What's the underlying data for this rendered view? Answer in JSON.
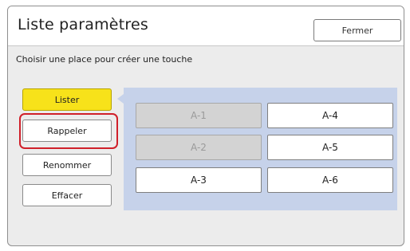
{
  "dialog": {
    "title": "Liste paramètres",
    "close_label": "Fermer",
    "instruction": "Choisir une place pour créer une touche"
  },
  "sidebar": {
    "items": [
      {
        "label": "Lister",
        "active": true
      },
      {
        "label": "Rappeler",
        "highlighted": true
      },
      {
        "label": "Renommer"
      },
      {
        "label": "Effacer"
      }
    ]
  },
  "slots": [
    {
      "label": "A-1",
      "enabled": false
    },
    {
      "label": "A-2",
      "enabled": false
    },
    {
      "label": "A-3",
      "enabled": true
    },
    {
      "label": "A-4",
      "enabled": true
    },
    {
      "label": "A-5",
      "enabled": true
    },
    {
      "label": "A-6",
      "enabled": true
    }
  ],
  "colors": {
    "active_button": "#f7e21a",
    "highlight_border": "#d0202a",
    "panel_background": "#c6d2ea"
  }
}
